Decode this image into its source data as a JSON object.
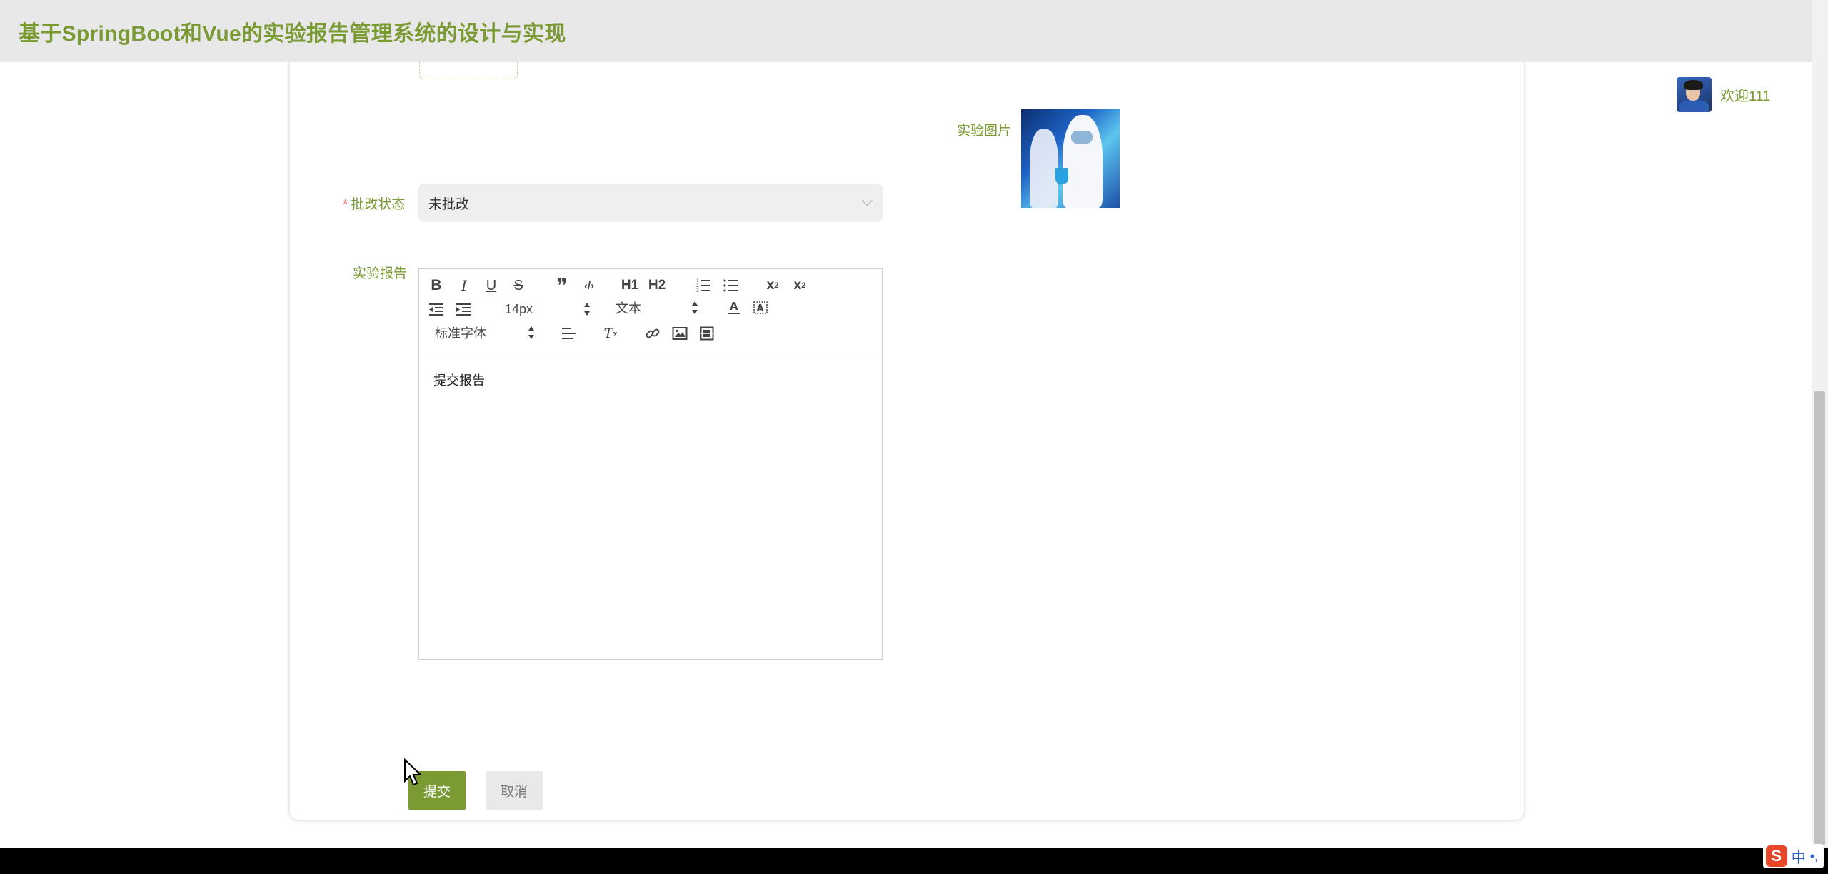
{
  "header": {
    "title": "基于SpringBoot和Vue的实验报告管理系统的设计与实现"
  },
  "user": {
    "welcome": "欢迎111",
    "avatar_icon": "user-avatar"
  },
  "form": {
    "image_label": "实验图片",
    "status_label": "批改状态",
    "status_required_mark": "*",
    "status_value": "未批改",
    "report_label": "实验报告",
    "report_content": "提交报告",
    "submit_label": "提交",
    "cancel_label": "取消"
  },
  "editor_toolbar": {
    "font_size": "14px",
    "header": "文本",
    "font_family": "标准字体",
    "h1": "H1",
    "h2": "H2",
    "buttons": [
      "bold-icon",
      "italic-icon",
      "underline-icon",
      "strike-icon",
      "blockquote-icon",
      "code-block-icon",
      "h1-icon",
      "h2-icon",
      "ordered-list-icon",
      "bullet-list-icon",
      "subscript-icon",
      "superscript-icon",
      "outdent-icon",
      "indent-icon",
      "font-color-icon",
      "background-color-icon",
      "align-icon",
      "clean-format-icon",
      "link-icon",
      "image-icon",
      "video-icon"
    ]
  },
  "ime": {
    "mode": "中"
  },
  "colors": {
    "accent": "#7a9a33",
    "required": "#f56c6c",
    "header_bg": "#e8e8e8"
  }
}
